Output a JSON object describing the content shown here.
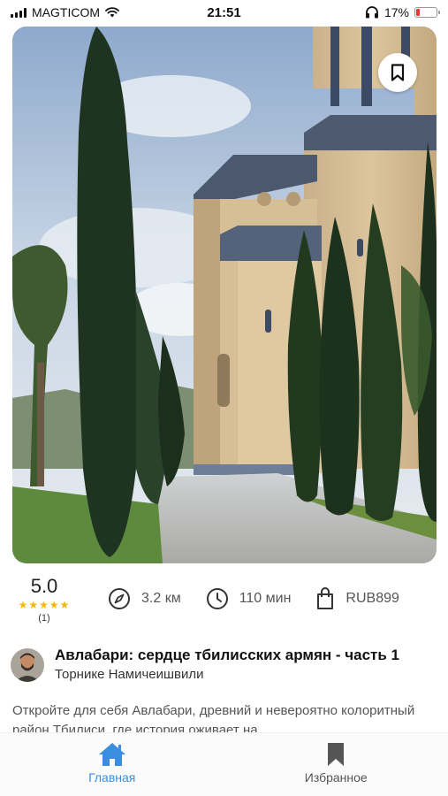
{
  "status_bar": {
    "carrier": "MAGTICOM",
    "time": "21:51",
    "battery_percent": "17%"
  },
  "hero": {
    "image_subject": "cathedral with cypress trees",
    "bookmark_icon": "bookmark-outline-icon"
  },
  "stats": {
    "rating": "5.0",
    "stars": "★★★★★",
    "rating_count": "(1)",
    "distance": "3.2 км",
    "duration": "110 мин",
    "price": "RUB899"
  },
  "tour": {
    "title": "Авлабари: сердце тбилисских армян - часть 1",
    "author": "Торнике Намичеишвили",
    "description": "Откройте для себя Авлабари, древний и невероятно колоритный район Тбилиси, где история оживает на"
  },
  "bottom_nav": {
    "items": [
      {
        "label": "Главная",
        "icon": "home-icon",
        "active": true
      },
      {
        "label": "Избранное",
        "icon": "bookmark-icon",
        "active": false
      }
    ]
  },
  "colors": {
    "accent": "#3b8de0",
    "star": "#f5b700",
    "battery_low": "#e53935"
  }
}
